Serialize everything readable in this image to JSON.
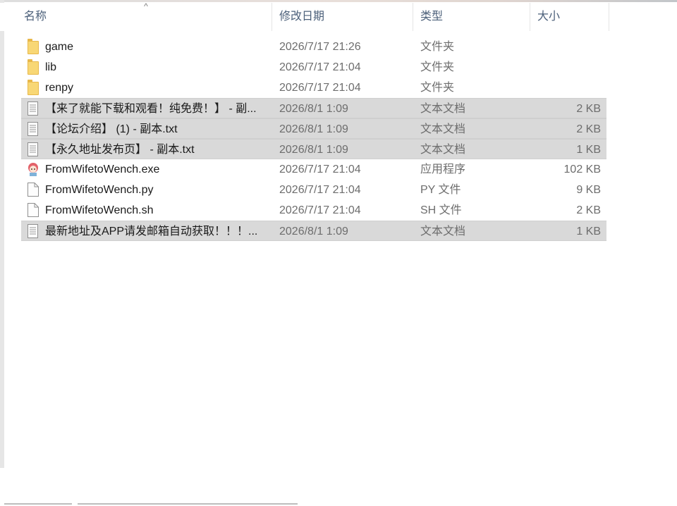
{
  "columns": {
    "name": "名称",
    "date": "修改日期",
    "type": "类型",
    "size": "大小"
  },
  "sort_indicator": "^",
  "files": [
    {
      "name": "game",
      "date": "2026/7/17 21:26",
      "type": "文件夹",
      "size": "",
      "icon": "folder-icon",
      "selected": false
    },
    {
      "name": "lib",
      "date": "2026/7/17 21:04",
      "type": "文件夹",
      "size": "",
      "icon": "folder-icon",
      "selected": false
    },
    {
      "name": "renpy",
      "date": "2026/7/17 21:04",
      "type": "文件夹",
      "size": "",
      "icon": "folder-icon",
      "selected": false
    },
    {
      "name": "【来了就能下载和观看！纯免费！】 - 副...",
      "date": "2026/8/1 1:09",
      "type": "文本文档",
      "size": "2 KB",
      "icon": "text-document-icon",
      "selected": true
    },
    {
      "name": "【论坛介绍】 (1) - 副本.txt",
      "date": "2026/8/1 1:09",
      "type": "文本文档",
      "size": "2 KB",
      "icon": "text-document-icon",
      "selected": true
    },
    {
      "name": "【永久地址发布页】 - 副本.txt",
      "date": "2026/8/1 1:09",
      "type": "文本文档",
      "size": "1 KB",
      "icon": "text-document-icon",
      "selected": true
    },
    {
      "name": "FromWifetoWench.exe",
      "date": "2026/7/17 21:04",
      "type": "应用程序",
      "size": "102 KB",
      "icon": "app-character-icon",
      "selected": false
    },
    {
      "name": "FromWifetoWench.py",
      "date": "2026/7/17 21:04",
      "type": "PY 文件",
      "size": "9 KB",
      "icon": "blank-file-icon",
      "selected": false
    },
    {
      "name": "FromWifetoWench.sh",
      "date": "2026/7/17 21:04",
      "type": "SH 文件",
      "size": "2 KB",
      "icon": "blank-file-icon",
      "selected": false
    },
    {
      "name": "最新地址及APP请发邮箱自动获取！！！...",
      "date": "2026/8/1 1:09",
      "type": "文本文档",
      "size": "1 KB",
      "icon": "text-document-icon",
      "selected": true
    }
  ],
  "colors": {
    "selection": "#d9d9d9",
    "header_text": "#4c607a",
    "folder": "#f8d775"
  }
}
